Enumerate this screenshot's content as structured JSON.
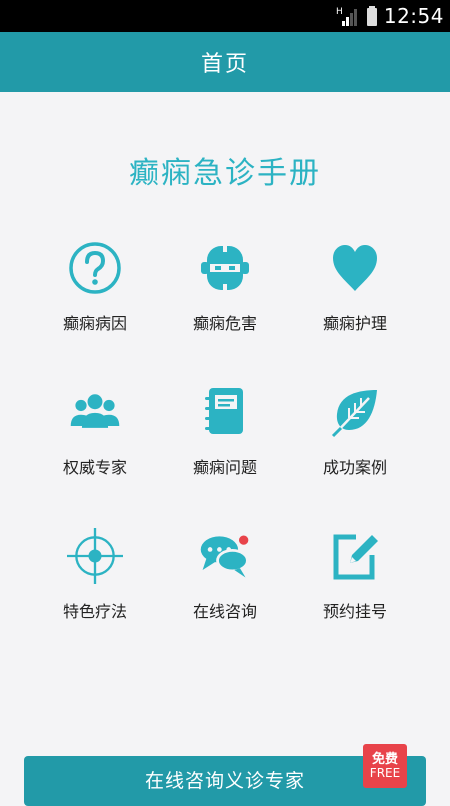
{
  "status_bar": {
    "time": "12:54",
    "network": "H"
  },
  "app_bar": {
    "title": "首页"
  },
  "main": {
    "title": "癫痫急诊手册",
    "menu": [
      {
        "label": "癫痫病因",
        "icon": "question-circle-icon"
      },
      {
        "label": "癫痫危害",
        "icon": "robot-face-icon"
      },
      {
        "label": "癫痫护理",
        "icon": "heart-icon"
      },
      {
        "label": "权威专家",
        "icon": "users-group-icon"
      },
      {
        "label": "癫痫问题",
        "icon": "notebook-icon"
      },
      {
        "label": "成功案例",
        "icon": "leaf-icon"
      },
      {
        "label": "特色疗法",
        "icon": "crosshair-icon"
      },
      {
        "label": "在线咨询",
        "icon": "chat-bubbles-icon"
      },
      {
        "label": "预约挂号",
        "icon": "edit-note-icon"
      }
    ]
  },
  "bottom": {
    "button_label": "在线咨询义诊专家",
    "badge_line1": "免费",
    "badge_line2": "FREE"
  },
  "colors": {
    "accent": "#229aa8",
    "icon": "#2cb3c3",
    "badge": "#e8434a"
  }
}
